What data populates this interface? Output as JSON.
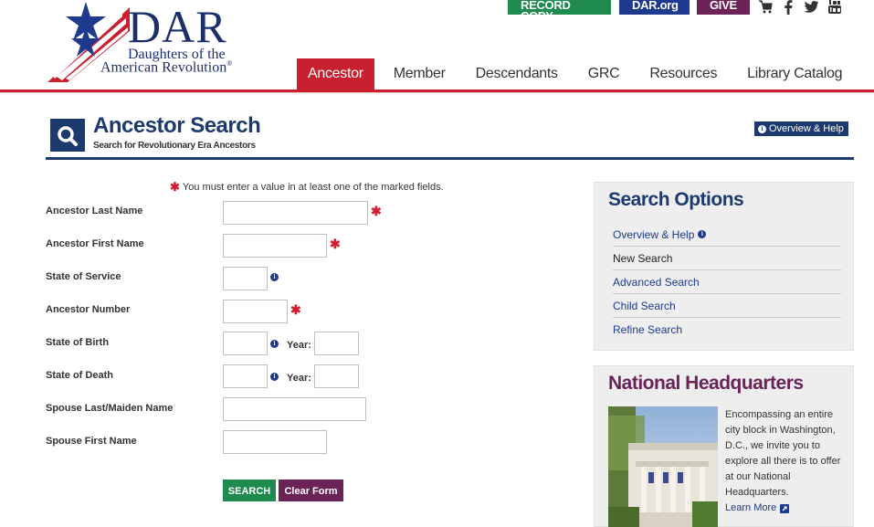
{
  "header": {
    "logo": {
      "main": "DAR",
      "line1": "Daughters of the",
      "line2": "American Revolution",
      "registered": "®"
    },
    "top_buttons": {
      "record": "RECORD COPY",
      "org": "DAR.org",
      "give": "GIVE"
    },
    "social_icons": [
      "cart-icon",
      "facebook-icon",
      "twitter-icon",
      "youtube-icon"
    ],
    "nav": [
      "Ancestor",
      "Member",
      "Descendants",
      "GRC",
      "Resources",
      "Library Catalog"
    ]
  },
  "title": {
    "heading": "Ancestor Search",
    "subheading": "Search for Revolutionary Era Ancestors",
    "overview_btn": "Overview & Help"
  },
  "form": {
    "required_note": "You must enter a value in at least one of the marked fields.",
    "last_name": "Ancestor Last Name",
    "first_name": "Ancestor First Name",
    "state_service": "State of Service",
    "ancestor_number": "Ancestor Number",
    "state_birth": "State of Birth",
    "state_death": "State of Death",
    "year_label": "Year:",
    "spouse_last": "Spouse Last/Maiden Name",
    "spouse_first": "Spouse First Name",
    "search_btn": "SEARCH",
    "clear_btn": "Clear Form"
  },
  "search_options": {
    "title": "Search Options",
    "items": [
      "Overview & Help",
      "New Search",
      "Advanced Search",
      "Child Search",
      "Refine Search"
    ]
  },
  "hq": {
    "title": "National Headquarters",
    "text": "Encompassing an entire city block in Washington, D.C., we invite you to explore all there is to offer at our National Headquarters.",
    "link": "Learn More"
  },
  "colors": {
    "red": "#c8202f",
    "navy": "#1d3a6e",
    "green": "#1e8a4e",
    "plum": "#6b2357"
  }
}
